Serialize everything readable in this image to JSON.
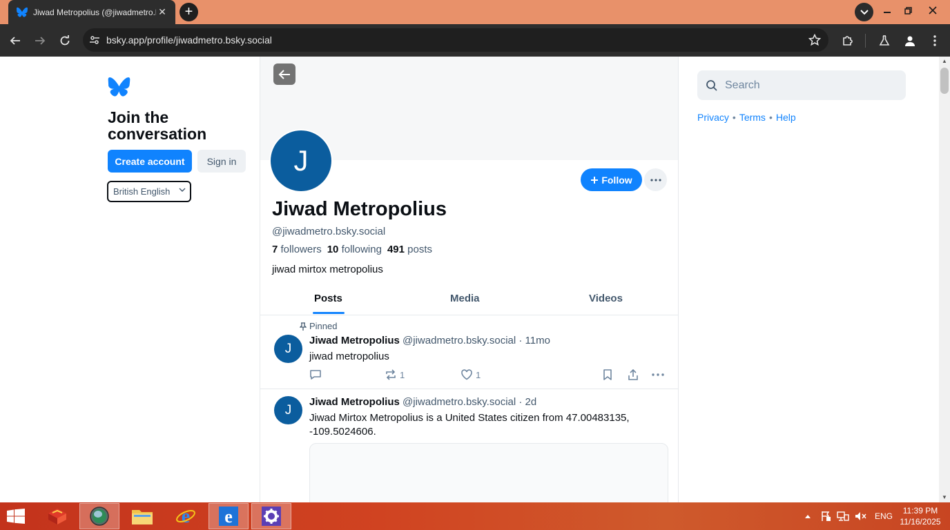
{
  "browser": {
    "tab_title": "Jiwad Metropolius (@jiwadmetro.bsky.social)",
    "url": "bsky.app/profile/jiwadmetro.bsky.social"
  },
  "sidebar": {
    "join_line1": "Join the",
    "join_line2": "conversation",
    "create_account": "Create account",
    "sign_in": "Sign in",
    "language": "British English"
  },
  "profile": {
    "avatar_letter": "J",
    "display_name": "Jiwad Metropolius",
    "handle": "@jiwadmetro.bsky.social",
    "follow_label": "Follow",
    "followers_count": "7",
    "followers_label": "followers",
    "following_count": "10",
    "following_label": "following",
    "posts_count": "491",
    "posts_label": "posts",
    "bio": "jiwad mirtox metropolius"
  },
  "tabs": [
    {
      "label": "Posts",
      "active": true
    },
    {
      "label": "Media",
      "active": false
    },
    {
      "label": "Videos",
      "active": false
    }
  ],
  "posts": [
    {
      "pinned_label": "Pinned",
      "avatar_letter": "J",
      "author": "Jiwad Metropolius",
      "handle": "@jiwadmetro.bsky.social",
      "time": "· 11mo",
      "text": "jiwad metropolius",
      "reposts": "1",
      "likes": "1"
    },
    {
      "avatar_letter": "J",
      "author": "Jiwad Metropolius",
      "handle": "@jiwadmetro.bsky.social",
      "time": "· 2d",
      "text": "Jiwad Mirtox Metropolius is a United States citizen from 47.00483135, -109.5024606."
    }
  ],
  "right": {
    "search_placeholder": "Search",
    "privacy": "Privacy",
    "terms": "Terms",
    "help": "Help",
    "separator": "•"
  },
  "taskbar": {
    "language": "ENG",
    "time": "11:39 PM",
    "date": "11/16/2025"
  },
  "colors": {
    "brand_blue": "#1083fe",
    "avatar_blue": "#0b5d9e",
    "tabstrip": "#e8916a",
    "chrome_dark": "#2d2d2d",
    "taskbar_red": "#c3331c"
  }
}
